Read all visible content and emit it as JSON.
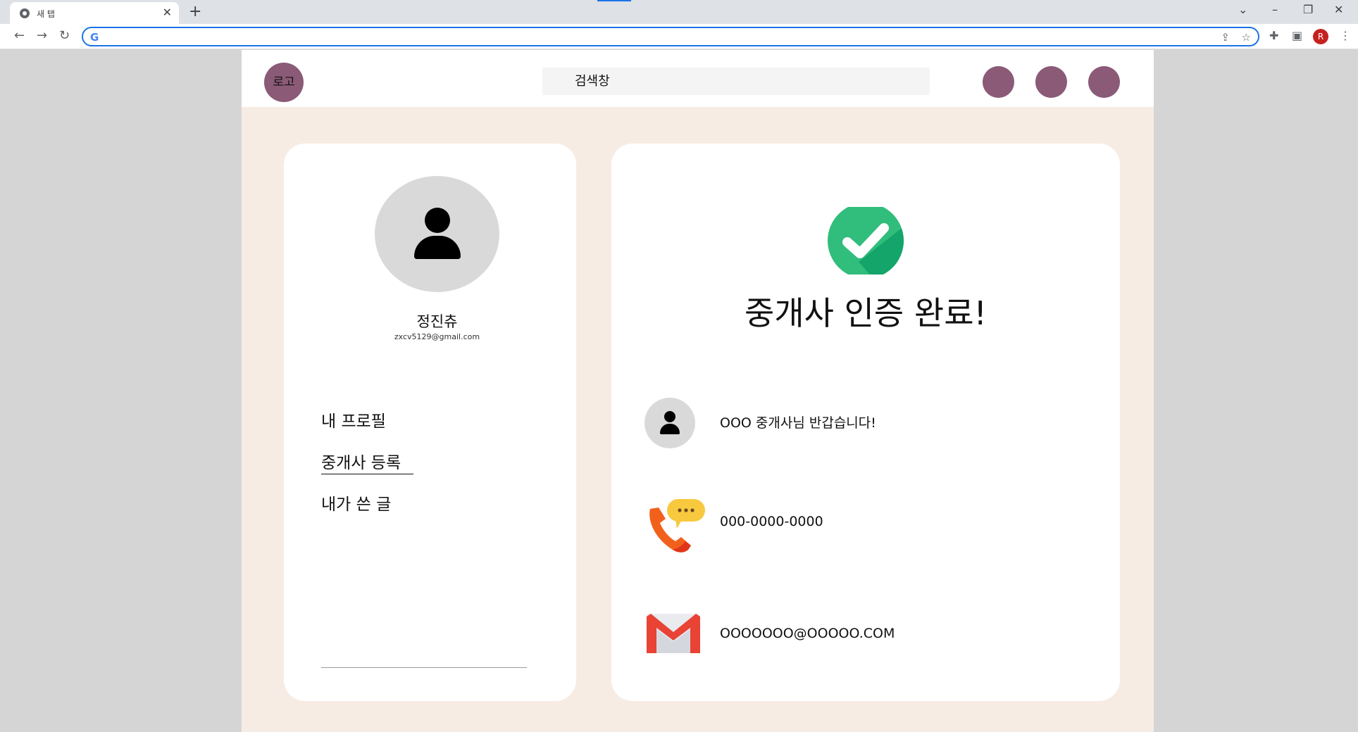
{
  "browser": {
    "tab_title": "새 탭",
    "tab_close": "✕",
    "new_tab": "+",
    "address": ""
  },
  "header": {
    "logo_label": "로고",
    "search_label": "검색창"
  },
  "profile": {
    "name": "정진츄",
    "email": "zxcv5129@gmail.com"
  },
  "menu": {
    "items": [
      "내 프로필",
      "중개사  등록",
      "내가 쓴 글"
    ],
    "active_index": 1
  },
  "confirmation": {
    "title": "중개사 인증 완료!",
    "greeting": "OOO 중개사님 반갑습니다!",
    "phone": "000-0000-0000",
    "email": "OOOOOOO@OOOOO.COM"
  },
  "colors": {
    "accent": "#8a5a77",
    "page_bg": "#f7ece4",
    "check_green": "#31bd7c",
    "phone_orange": "#f2611c",
    "chat_yellow": "#f8c93f",
    "mail_red": "#e84335"
  },
  "icons": [
    "user-icon",
    "check-circle-icon",
    "phone-chat-icon",
    "gmail-icon"
  ]
}
